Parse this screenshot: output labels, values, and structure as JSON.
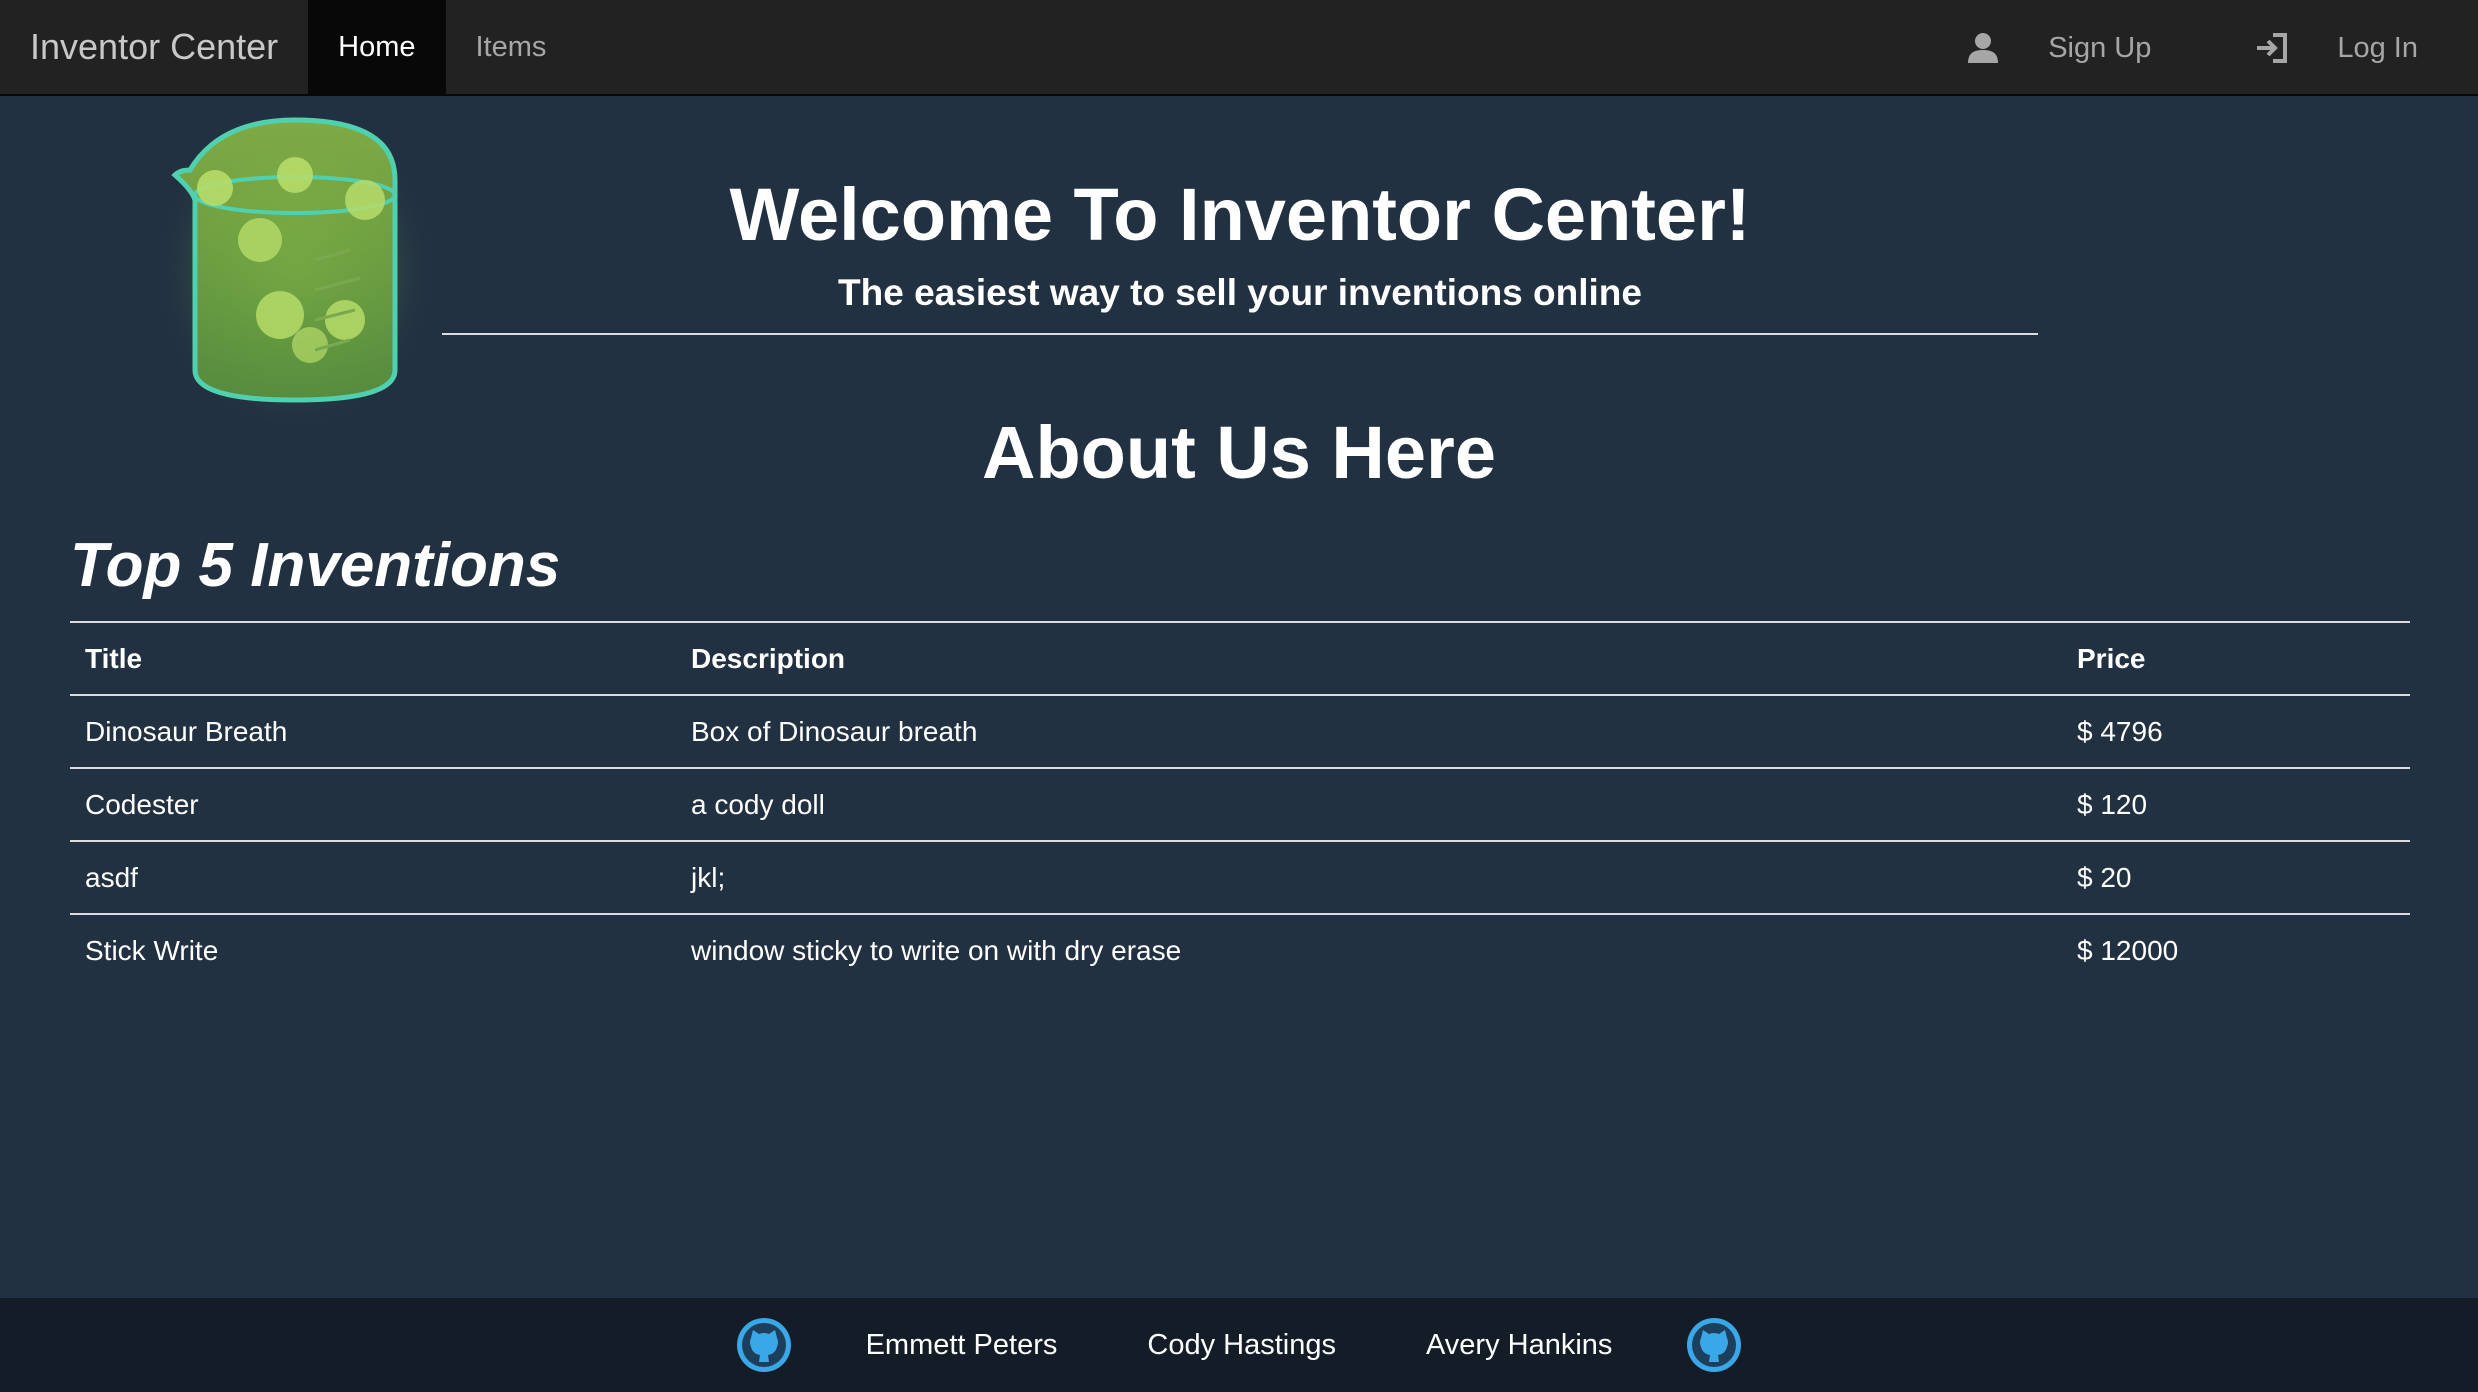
{
  "navbar": {
    "brand": "Inventor Center",
    "items": [
      {
        "label": "Home",
        "active": true
      },
      {
        "label": "Items",
        "active": false
      }
    ],
    "signup_label": "Sign Up",
    "signup_icon": "user-icon",
    "login_label": "Log In",
    "login_icon": "log-in-icon"
  },
  "hero": {
    "title": "Welcome To Inventor Center!",
    "subtitle": "The easiest way to sell your inventions online",
    "logo_icon": "beaker-icon"
  },
  "about": {
    "title": "About Us Here"
  },
  "top_inventions": {
    "title": "Top 5 Inventions",
    "columns": [
      "Title",
      "Description",
      "Price"
    ],
    "rows": [
      {
        "title": "Dinosaur Breath",
        "description": "Box of Dinosaur breath",
        "price": "$ 4796"
      },
      {
        "title": "Codester",
        "description": "a cody doll",
        "price": "$ 120"
      },
      {
        "title": "asdf",
        "description": "jkl;",
        "price": "$ 20"
      },
      {
        "title": "Stick Write",
        "description": "window sticky to write on with dry erase",
        "price": "$ 12000"
      }
    ]
  },
  "footer": {
    "left_icon": "github-icon",
    "right_icon": "github-icon",
    "names": [
      "Emmett Peters",
      "Cody Hastings",
      "Avery Hankins"
    ]
  },
  "colors": {
    "background": "#223142",
    "navbar": "#222222",
    "footer": "#141d27",
    "github_blue": "#3aa8e8",
    "beaker_green": "#8bc34a"
  }
}
